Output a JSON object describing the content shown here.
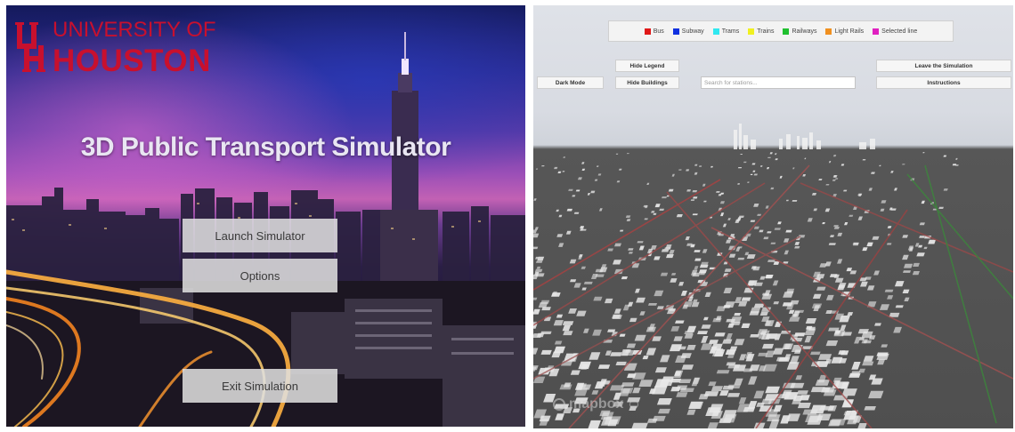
{
  "menu": {
    "logo": {
      "line1": "UNIVERSITY OF",
      "line2": "HOUSTON",
      "emblem_icon": "uh-interlocking-logo"
    },
    "title": "3D Public Transport Simulator",
    "buttons": {
      "launch": "Launch Simulator",
      "options": "Options",
      "exit": "Exit Simulation"
    },
    "colors": {
      "brand_red": "#c8102e",
      "button_bg": "#e1e1e1"
    }
  },
  "simulator": {
    "legend": [
      {
        "label": "Bus",
        "color": "#e01818"
      },
      {
        "label": "Subway",
        "color": "#1030e0"
      },
      {
        "label": "Trams",
        "color": "#30e8f0"
      },
      {
        "label": "Trains",
        "color": "#f0f020"
      },
      {
        "label": "Railways",
        "color": "#20c030"
      },
      {
        "label": "Light Rails",
        "color": "#f09020"
      },
      {
        "label": "Selected line",
        "color": "#e020c0"
      }
    ],
    "buttons": {
      "hide_legend": "Hide Legend",
      "dark_mode": "Dark Mode",
      "hide_buildings": "Hide Buildings",
      "leave": "Leave the Simulation",
      "instructions": "Instructions"
    },
    "search": {
      "placeholder": "Search for stations...",
      "value": ""
    },
    "attribution": {
      "brand": "mapbox",
      "brand_icon": "mapbox-icon",
      "info_icon": "info-icon"
    }
  }
}
